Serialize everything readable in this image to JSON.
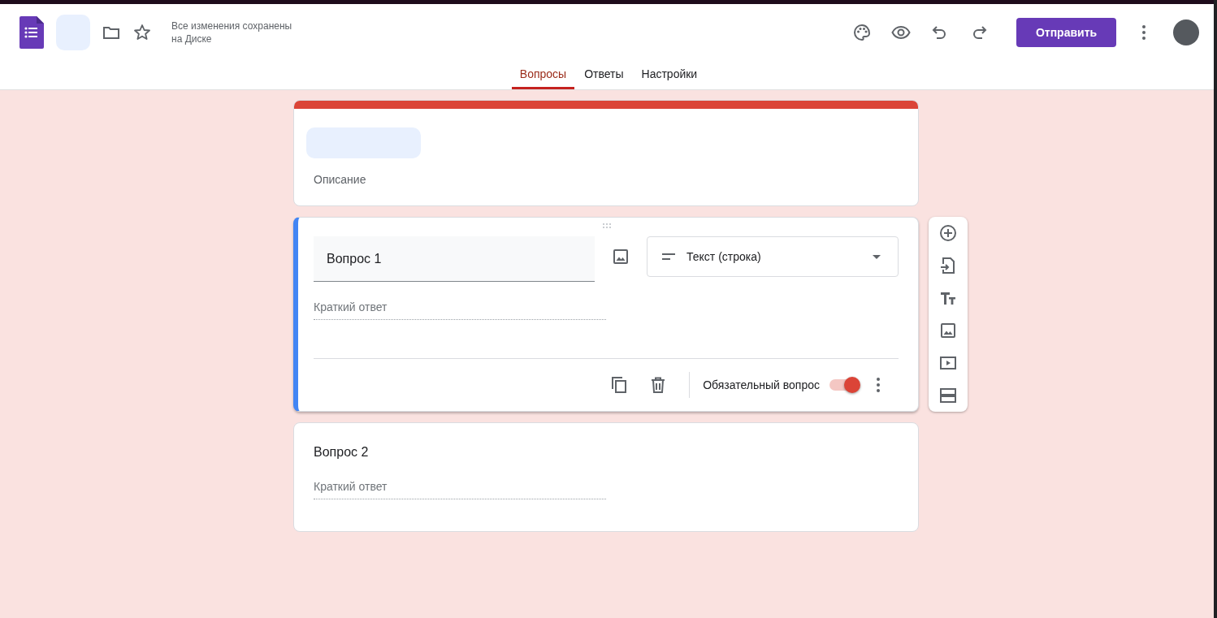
{
  "header": {
    "save_status": "Все изменения сохранены на Диске",
    "send_button": "Отправить"
  },
  "tabs": [
    {
      "label": "Вопросы",
      "selected": true
    },
    {
      "label": "Ответы",
      "selected": false
    },
    {
      "label": "Настройки",
      "selected": false
    }
  ],
  "form_header": {
    "description_placeholder": "Описание"
  },
  "questions": [
    {
      "kind": "active",
      "title": "Вопрос 1",
      "answer_placeholder": "Краткий ответ",
      "type": "Текст (строка)",
      "required_label": "Обязательный вопрос",
      "required": true
    },
    {
      "kind": "collapsed",
      "title": "Вопрос 2",
      "answer_placeholder": "Краткий ответ"
    }
  ]
}
